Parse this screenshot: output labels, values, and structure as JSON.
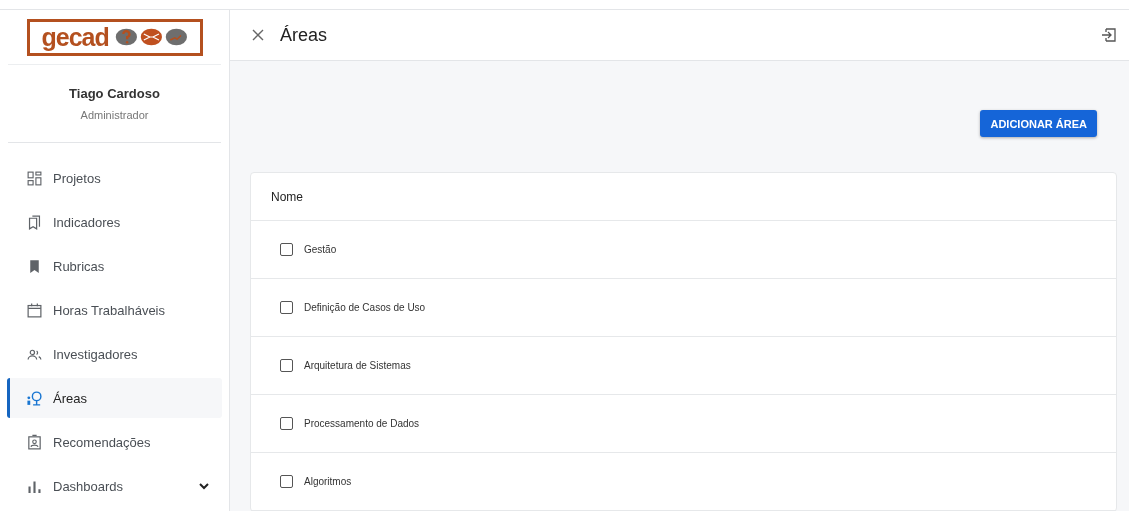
{
  "logo": {
    "text": "gecad"
  },
  "user": {
    "name": "Tiago Cardoso",
    "role": "Administrador"
  },
  "sidebar": {
    "items": [
      {
        "label": "Projetos",
        "kind": "link",
        "selected": false
      },
      {
        "label": "Indicadores",
        "kind": "link",
        "selected": false
      },
      {
        "label": "Rubricas",
        "kind": "link",
        "selected": false
      },
      {
        "label": "Horas Trabalháveis",
        "kind": "link",
        "selected": false
      },
      {
        "label": "Investigadores",
        "kind": "link",
        "selected": false
      },
      {
        "label": "Áreas",
        "kind": "link",
        "selected": true
      },
      {
        "label": "Recomendações",
        "kind": "link",
        "selected": false
      },
      {
        "label": "Dashboards",
        "kind": "group",
        "selected": false,
        "expanded": false
      }
    ]
  },
  "header": {
    "title": "Áreas"
  },
  "add_button": "ADICIONAR ÁREA",
  "table": {
    "columns": [
      "Nome"
    ],
    "rows": [
      {
        "name": "Gestão",
        "checked": false
      },
      {
        "name": "Definição de Casos de Uso",
        "checked": false
      },
      {
        "name": "Arquitetura de Sistemas",
        "checked": false
      },
      {
        "name": "Processamento de Dados",
        "checked": false
      },
      {
        "name": "Algoritmos",
        "checked": false
      }
    ]
  }
}
